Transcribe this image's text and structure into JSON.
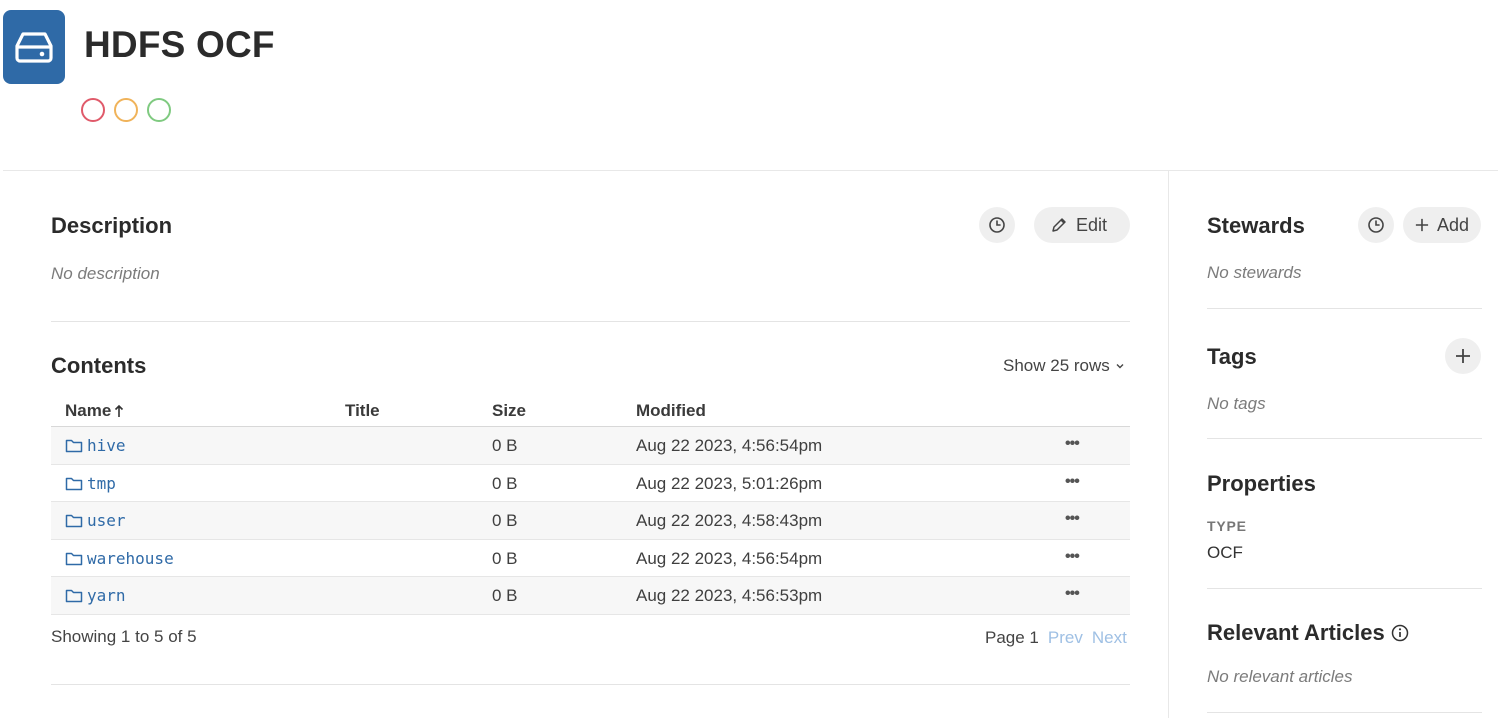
{
  "header": {
    "title": "HDFS OCF",
    "icon": "hard-drive-icon",
    "brand_color": "#2f6aa7",
    "status_dots": [
      {
        "name": "red",
        "color": "#e05a6a"
      },
      {
        "name": "yellow",
        "color": "#f0b35a"
      },
      {
        "name": "green",
        "color": "#7fca80"
      }
    ]
  },
  "description": {
    "title": "Description",
    "empty_text": "No description",
    "edit_label": "Edit"
  },
  "contents": {
    "title": "Contents",
    "show_rows_label": "Show 25 rows",
    "columns": {
      "name": "Name",
      "title": "Title",
      "size": "Size",
      "modified": "Modified"
    },
    "rows": [
      {
        "name": "hive",
        "title": "",
        "size": "0 B",
        "modified": "Aug 22 2023, 4:56:54pm"
      },
      {
        "name": "tmp",
        "title": "",
        "size": "0 B",
        "modified": "Aug 22 2023, 5:01:26pm"
      },
      {
        "name": "user",
        "title": "",
        "size": "0 B",
        "modified": "Aug 22 2023, 4:58:43pm"
      },
      {
        "name": "warehouse",
        "title": "",
        "size": "0 B",
        "modified": "Aug 22 2023, 4:56:54pm"
      },
      {
        "name": "yarn",
        "title": "",
        "size": "0 B",
        "modified": "Aug 22 2023, 4:56:53pm"
      }
    ],
    "more_glyph": "•••",
    "showing_text": "Showing 1 to 5 of 5",
    "page_label": "Page 1",
    "prev_label": "Prev",
    "next_label": "Next"
  },
  "sidebar": {
    "stewards": {
      "title": "Stewards",
      "add_label": "Add",
      "empty_text": "No stewards"
    },
    "tags": {
      "title": "Tags",
      "empty_text": "No tags"
    },
    "properties": {
      "title": "Properties",
      "type_key": "TYPE",
      "type_value": "OCF"
    },
    "articles": {
      "title": "Relevant Articles",
      "empty_text": "No relevant articles"
    }
  }
}
